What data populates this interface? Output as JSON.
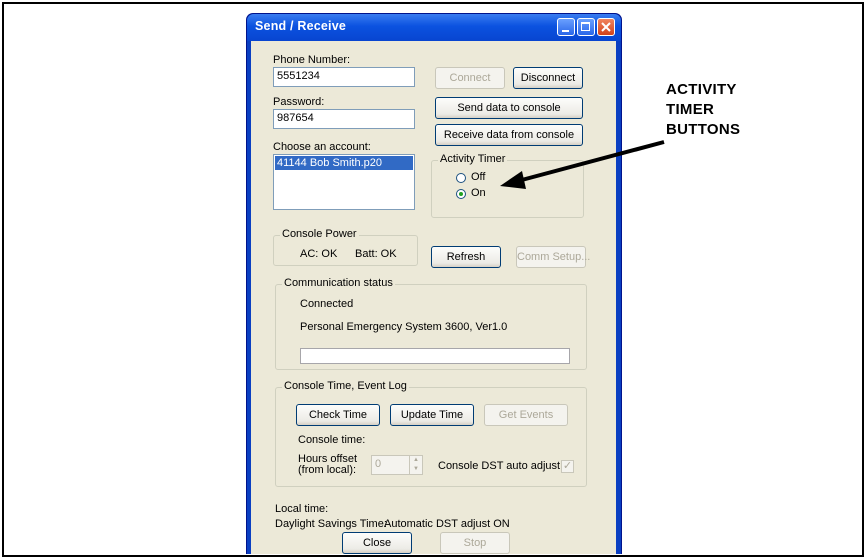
{
  "window": {
    "title": "Send / Receive"
  },
  "form": {
    "phone_label": "Phone Number:",
    "phone_value": "5551234",
    "password_label": "Password:",
    "password_value": "987654",
    "account_label": "Choose an account:",
    "accounts": [
      "41144 Bob Smith.p20"
    ]
  },
  "buttons": {
    "connect": "Connect",
    "disconnect": "Disconnect",
    "send_data": "Send data to console",
    "receive_data": "Receive data from console",
    "refresh": "Refresh",
    "comm_setup": "Comm Setup...",
    "check_time": "Check Time",
    "update_time": "Update Time",
    "get_events": "Get Events",
    "close": "Close",
    "stop": "Stop"
  },
  "activity_timer": {
    "title": "Activity Timer",
    "off_label": "Off",
    "on_label": "On",
    "selected": "On"
  },
  "console_power": {
    "title": "Console Power",
    "ac": "AC: OK",
    "batt": "Batt: OK"
  },
  "comm_status": {
    "title": "Communication status",
    "status": "Connected",
    "device": "Personal Emergency System 3600, Ver1.0",
    "progress": 0
  },
  "console_time": {
    "title": "Console Time, Event Log",
    "console_time_label": "Console time:",
    "hours_offset_label_1": "Hours offset",
    "hours_offset_label_2": "(from local):",
    "hours_offset_value": "0",
    "dst_label": "Console DST auto adjust:",
    "dst_checked": true
  },
  "footer": {
    "local_time_label": "Local time:",
    "dst_label": "Daylight Savings Time:",
    "dst_value": "Automatic DST adjust ON"
  },
  "callout": {
    "line1": "ACTIVITY",
    "line2": "TIMER",
    "line3": "BUTTONS"
  }
}
